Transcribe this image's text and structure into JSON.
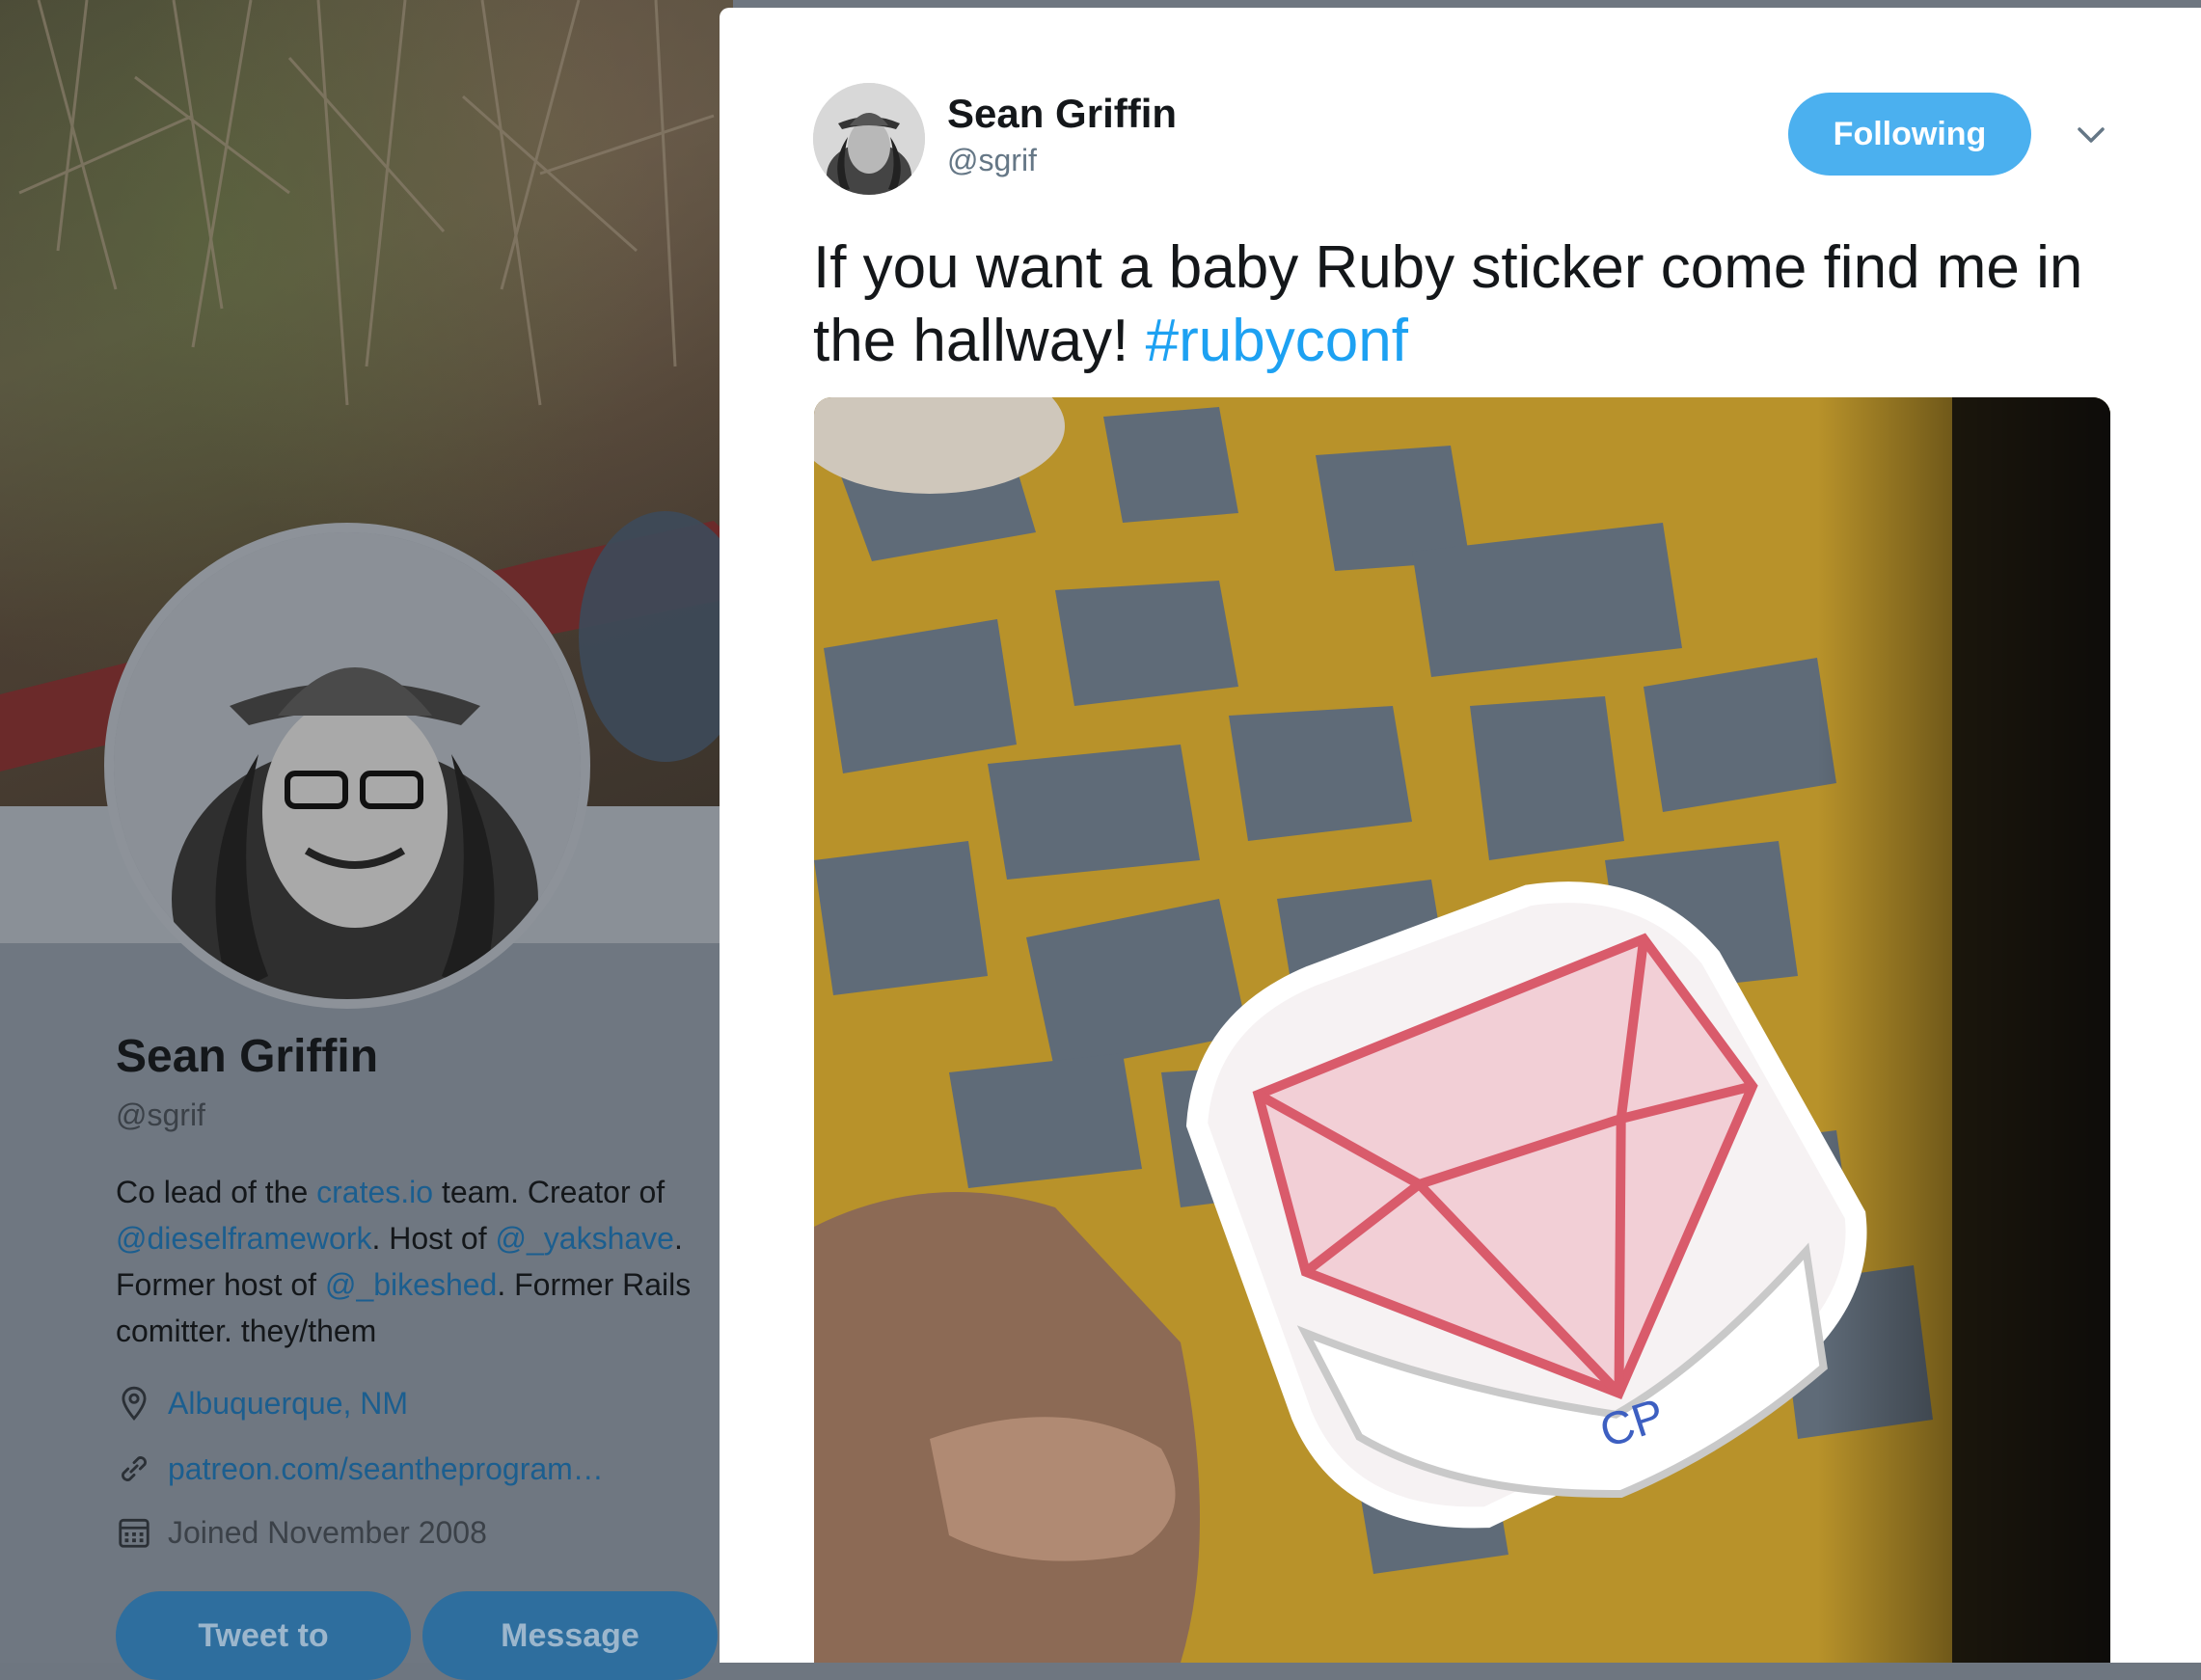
{
  "profile": {
    "name": "Sean Griffin",
    "handle": "@sgrif",
    "bio": {
      "t1": "Co lead of the ",
      "l1": "crates.io",
      "t2": " team. Creator of ",
      "l2": "@dieselframework",
      "t3": ". Host of ",
      "l3": "@_yakshave",
      "t4": ". Former host of ",
      "l4": "@_bikeshed",
      "t5": ". Former Rails comitter. they/them"
    },
    "location": "Albuquerque, NM",
    "website": "patreon.com/seantheprogram…",
    "joined": "Joined November 2008",
    "tweet_to_label": "Tweet to",
    "message_label": "Message"
  },
  "tweet": {
    "author_name": "Sean Griffin",
    "author_handle": "@sgrif",
    "follow_label": "Following",
    "text_main": "If you want a baby Ruby sticker come find me in the hallway! ",
    "hashtag": "#rubyconf"
  },
  "colors": {
    "accent": "#1da1f2",
    "following_button": "#4bb0ef",
    "dim_link": "#1b5e8f"
  },
  "icons": [
    "location-icon",
    "link-icon",
    "calendar-icon",
    "chevron-down-icon"
  ]
}
